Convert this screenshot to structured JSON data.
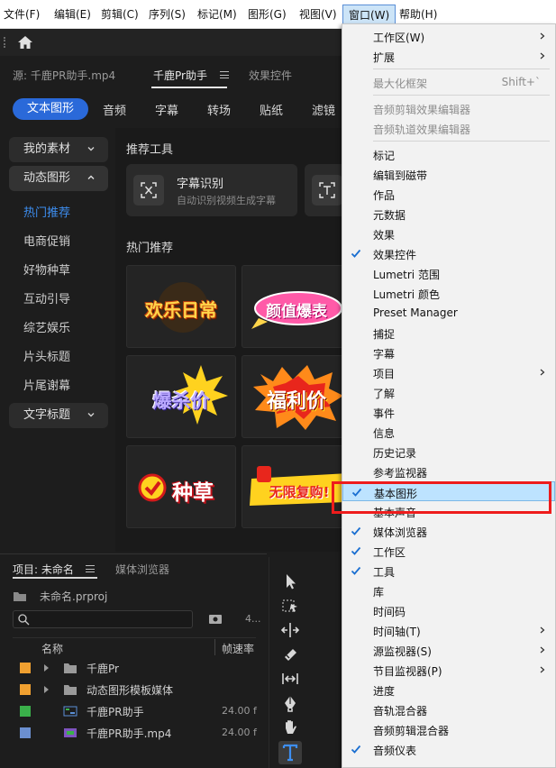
{
  "menubar": {
    "items": [
      "文件(F)",
      "编辑(E)",
      "剪辑(C)",
      "序列(S)",
      "标记(M)",
      "图形(G)",
      "视图(V)",
      "窗口(W)",
      "帮助(H)"
    ]
  },
  "panel": {
    "source_tab": "源: 千鹿PR助手.mp4",
    "plugin_tab": "千鹿Pr助手",
    "effects_tab": "效果控件"
  },
  "categories": [
    "文本图形",
    "音频",
    "字幕",
    "转场",
    "贴纸",
    "滤镜"
  ],
  "sidebar": {
    "my_assets": "我的素材",
    "motion_graphics": "动态图形",
    "items": [
      "热门推荐",
      "电商促销",
      "好物种草",
      "互动引导",
      "综艺娱乐",
      "片头标题",
      "片尾谢幕"
    ],
    "text_titles": "文字标题"
  },
  "content": {
    "tools_title": "推荐工具",
    "tool": {
      "title": "字幕识别",
      "desc": "自动识别视频生成字幕"
    },
    "hot_title": "热门推荐",
    "tiles": [
      "欢乐日常",
      "颜值爆表",
      "爆杀价",
      "福利价",
      "种草",
      "无限复购!"
    ]
  },
  "project": {
    "tab_project": "项目: 未命名",
    "tab_media": "媒体浏览器",
    "project_file": "未命名.prproj",
    "count_label": "4...",
    "col_name": "名称",
    "col_fps": "帧速率",
    "rows": [
      {
        "name": "千鹿Pr",
        "fps": "",
        "color": "#f0a030",
        "kind": "folder"
      },
      {
        "name": "动态图形模板媒体",
        "fps": "",
        "color": "#f0a030",
        "kind": "folder"
      },
      {
        "name": "千鹿PR助手",
        "fps": "24.00 f",
        "color": "#3ab04a",
        "kind": "sequence"
      },
      {
        "name": "千鹿PR助手.mp4",
        "fps": "24.00 f",
        "color": "#6b8fd0",
        "kind": "video"
      }
    ]
  },
  "tools": [
    "selection-tool",
    "track-select-tool",
    "ripple-edit-tool",
    "razor-tool",
    "slip-tool",
    "pen-tool",
    "hand-tool",
    "type-tool"
  ],
  "window_menu": {
    "items": [
      {
        "label": "工作区(W)",
        "submenu": true
      },
      {
        "label": "扩展",
        "submenu": true
      },
      {
        "label": "最大化框架",
        "shortcut": "Shift+`",
        "disabled": true
      },
      {
        "label": "音频剪辑效果编辑器",
        "disabled": true
      },
      {
        "label": "音频轨道效果编辑器",
        "disabled": true
      },
      {
        "label": "标记"
      },
      {
        "label": "编辑到磁带"
      },
      {
        "label": "作品"
      },
      {
        "label": "元数据"
      },
      {
        "label": "效果"
      },
      {
        "label": "效果控件",
        "checked": true
      },
      {
        "label": "Lumetri 范围"
      },
      {
        "label": "Lumetri 颜色"
      },
      {
        "label": "Preset Manager"
      },
      {
        "label": "捕捉"
      },
      {
        "label": "字幕"
      },
      {
        "label": "项目",
        "submenu": true
      },
      {
        "label": "了解"
      },
      {
        "label": "事件"
      },
      {
        "label": "信息"
      },
      {
        "label": "历史记录"
      },
      {
        "label": "参考监视器"
      },
      {
        "label": "基本图形",
        "checked": true,
        "highlighted": true
      },
      {
        "label": "基本声音"
      },
      {
        "label": "媒体浏览器",
        "checked": true
      },
      {
        "label": "工作区",
        "checked": true
      },
      {
        "label": "工具",
        "checked": true
      },
      {
        "label": "库"
      },
      {
        "label": "时间码"
      },
      {
        "label": "时间轴(T)",
        "submenu": true
      },
      {
        "label": "源监视器(S)",
        "submenu": true
      },
      {
        "label": "节目监视器(P)",
        "submenu": true
      },
      {
        "label": "进度"
      },
      {
        "label": "音轨混合器"
      },
      {
        "label": "音频剪辑混合器"
      },
      {
        "label": "音频仪表",
        "checked": true
      }
    ]
  },
  "colors": {
    "accent_blue": "#2a69d9",
    "active_link": "#3d8ef0",
    "highlight": "#bde3ff",
    "check": "#1a6fd1",
    "annotation_red": "#ee1c1c"
  }
}
